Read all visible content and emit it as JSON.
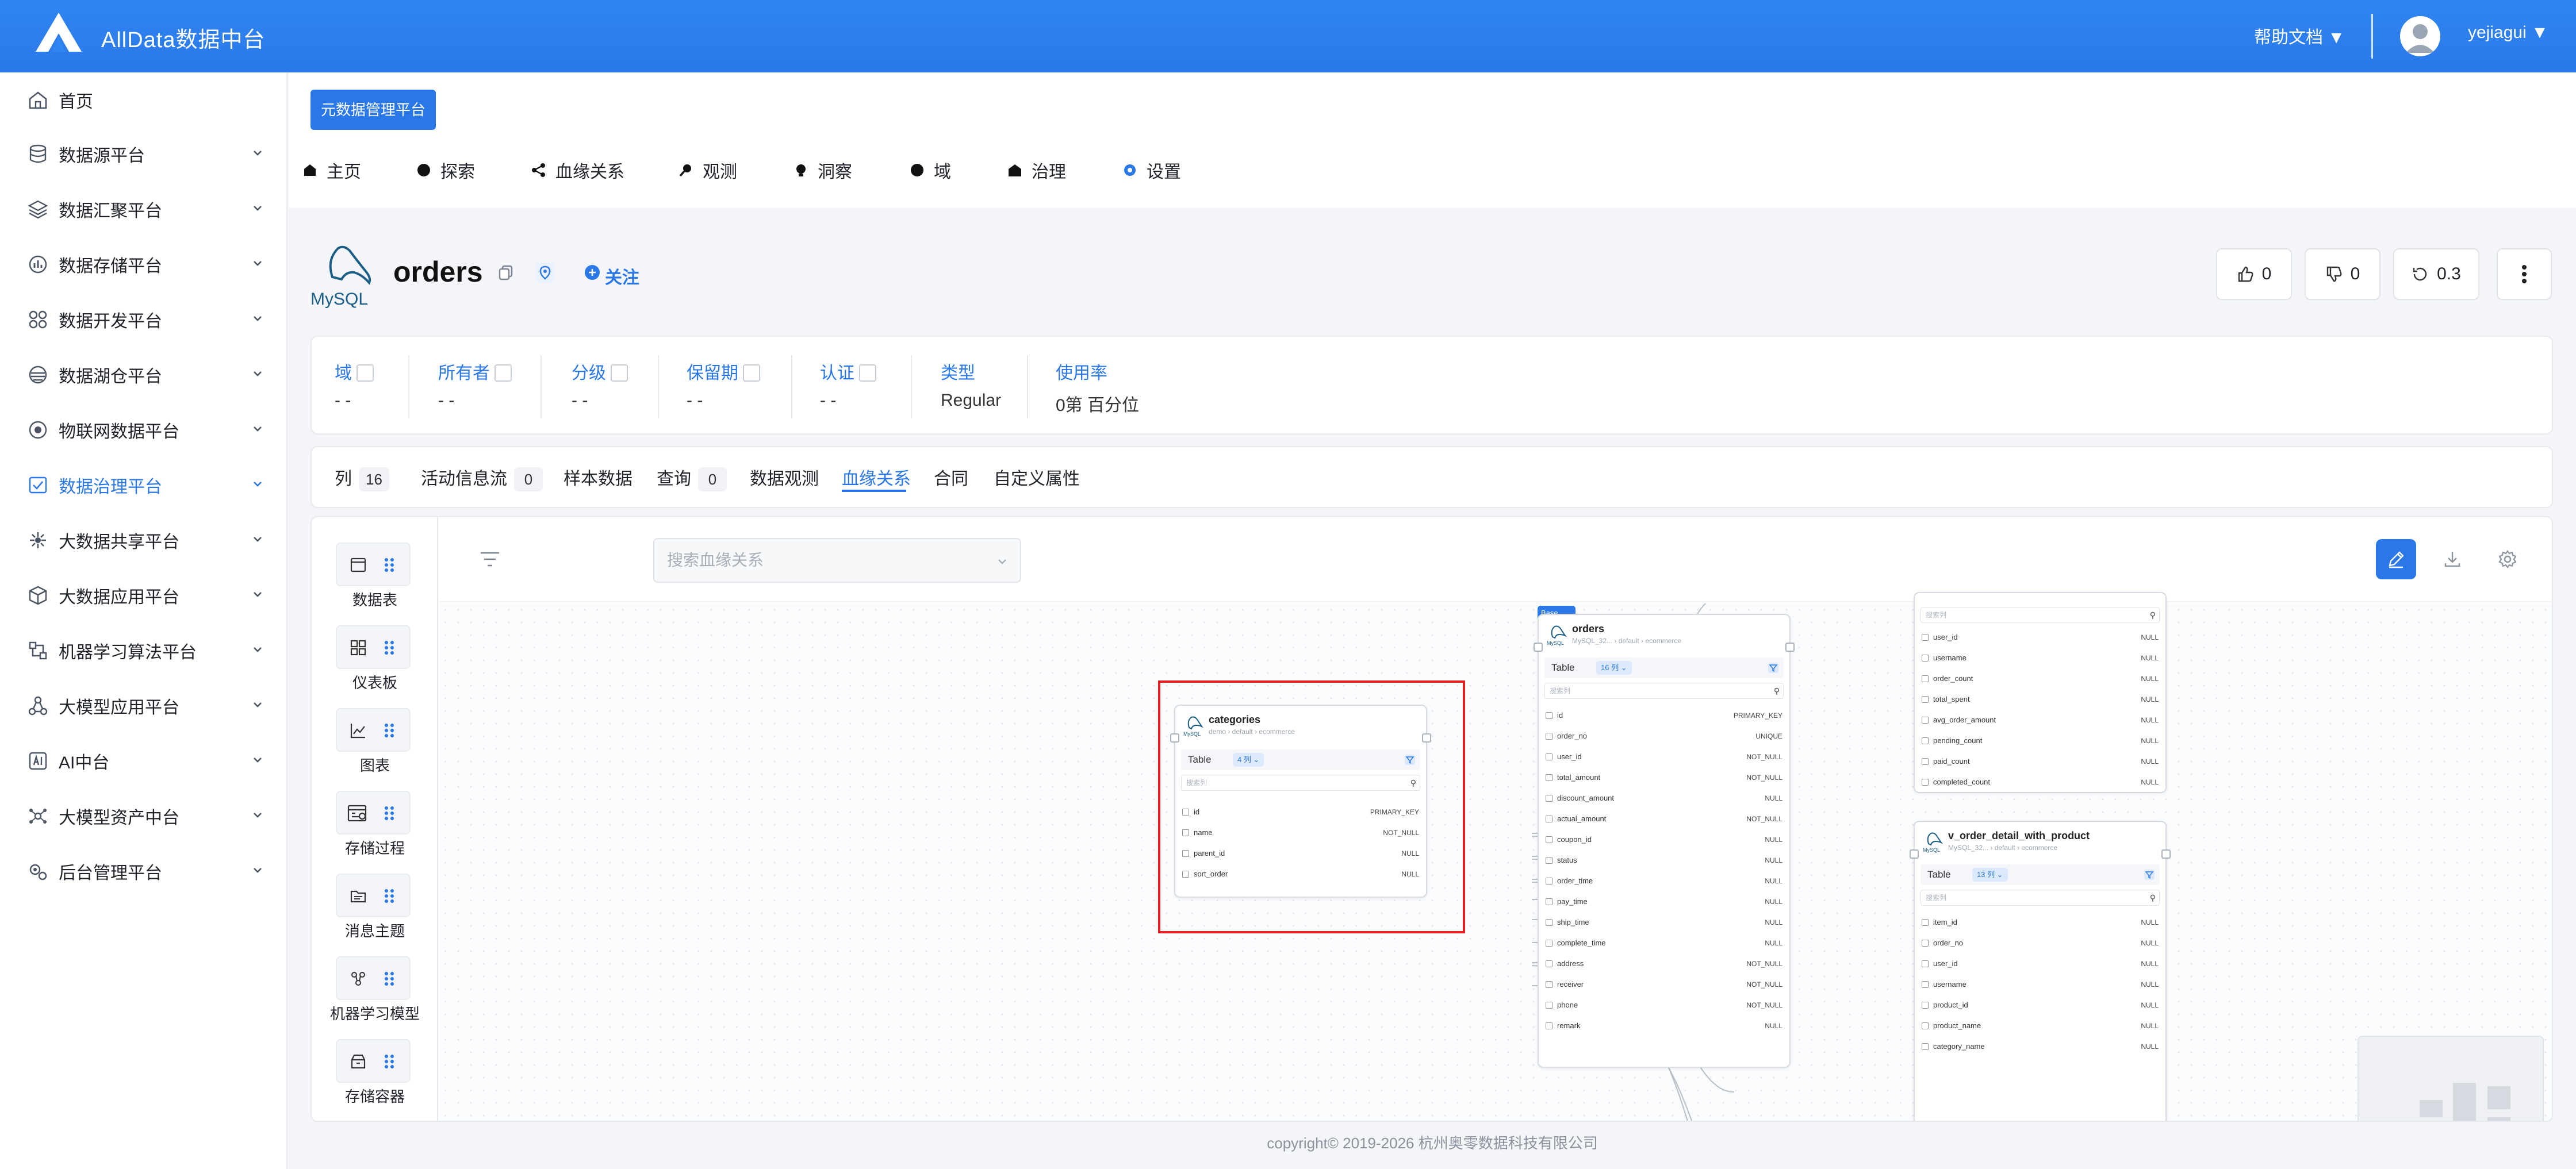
{
  "app": {
    "title": "AllData数据中台",
    "help": "帮助文档 ▼",
    "user": "yejiagui ▼"
  },
  "sidebar": {
    "items": [
      {
        "label": "首页",
        "icon": "home-icon"
      },
      {
        "label": "数据源平台",
        "icon": "database-icon"
      },
      {
        "label": "数据汇聚平台",
        "icon": "layers-icon"
      },
      {
        "label": "数据存储平台",
        "icon": "bar-chart-icon"
      },
      {
        "label": "数据开发平台",
        "icon": "code-nodes-icon"
      },
      {
        "label": "数据湖仓平台",
        "icon": "lake-icon"
      },
      {
        "label": "物联网数据平台",
        "icon": "iot-icon"
      },
      {
        "label": "数据治理平台",
        "icon": "governance-icon"
      },
      {
        "label": "大数据共享平台",
        "icon": "share-icon"
      },
      {
        "label": "大数据应用平台",
        "icon": "cube-icon"
      },
      {
        "label": "机器学习算法平台",
        "icon": "ml-icon"
      },
      {
        "label": "大模型应用平台",
        "icon": "model-icon"
      },
      {
        "label": "AI中台",
        "icon": "ai-icon"
      },
      {
        "label": "大模型资产中台",
        "icon": "asset-icon"
      },
      {
        "label": "后台管理平台",
        "icon": "gears-icon"
      }
    ]
  },
  "header": {
    "meta_button": "元数据管理平台",
    "nav": [
      "主页",
      "探索",
      "血缘关系",
      "观测",
      "洞察",
      "域",
      "治理",
      "设置"
    ]
  },
  "entity": {
    "name": "orders",
    "follow": "关注",
    "upvotes": "0",
    "downvotes": "0",
    "version": "0.3",
    "mysql_logo": "MySQL"
  },
  "meta": [
    {
      "label": "域",
      "value": "- -"
    },
    {
      "label": "所有者",
      "value": "- -"
    },
    {
      "label": "分级",
      "value": "- -"
    },
    {
      "label": "保留期",
      "value": "- -"
    },
    {
      "label": "认证",
      "value": "- -"
    },
    {
      "label": "类型",
      "value": "Regular"
    },
    {
      "label": "使用率",
      "value": "0第 百分位"
    }
  ],
  "tabs": [
    {
      "label": "列",
      "badge": "16"
    },
    {
      "label": "活动信息流",
      "badge": "0"
    },
    {
      "label": "样本数据",
      "badge": ""
    },
    {
      "label": "查询",
      "badge": "0"
    },
    {
      "label": "数据观测",
      "badge": ""
    },
    {
      "label": "血缘关系",
      "badge": ""
    },
    {
      "label": "合同",
      "badge": ""
    },
    {
      "label": "自定义属性",
      "badge": ""
    }
  ],
  "lineage": {
    "search_placeholder": "搜索血缘关系",
    "palette": [
      "数据表",
      "仪表板",
      "图表",
      "存储过程",
      "消息主题",
      "机器学习模型",
      "存储容器"
    ],
    "search_column": "搜索列",
    "nodes": {
      "categories": {
        "name": "categories",
        "sub": "demo  ›  default  ›  ecommerce",
        "type": "Table",
        "count": "4 列 ⌄",
        "rows": [
          {
            "name": "id",
            "con": "PRIMARY_KEY"
          },
          {
            "name": "name",
            "con": "NOT_NULL"
          },
          {
            "name": "parent_id",
            "con": "NULL"
          },
          {
            "name": "sort_order",
            "con": "NULL"
          }
        ]
      },
      "orders": {
        "tag": "Base",
        "name": "orders",
        "sub": "MySQL_32...  ›  default  ›  ecommerce",
        "type": "Table",
        "count": "16 列 ⌄",
        "rows": [
          {
            "name": "id",
            "con": "PRIMARY_KEY"
          },
          {
            "name": "order_no",
            "con": "UNIQUE"
          },
          {
            "name": "user_id",
            "con": "NOT_NULL"
          },
          {
            "name": "total_amount",
            "con": "NOT_NULL"
          },
          {
            "name": "discount_amount",
            "con": "NULL"
          },
          {
            "name": "actual_amount",
            "con": "NOT_NULL"
          },
          {
            "name": "coupon_id",
            "con": "NULL"
          },
          {
            "name": "status",
            "con": "NULL"
          },
          {
            "name": "order_time",
            "con": "NULL"
          },
          {
            "name": "pay_time",
            "con": "NULL"
          },
          {
            "name": "ship_time",
            "con": "NULL"
          },
          {
            "name": "complete_time",
            "con": "NULL"
          },
          {
            "name": "address",
            "con": "NOT_NULL"
          },
          {
            "name": "receiver",
            "con": "NOT_NULL"
          },
          {
            "name": "phone",
            "con": "NOT_NULL"
          },
          {
            "name": "remark",
            "con": "NULL"
          }
        ]
      },
      "user_stats": {
        "search": "搜索列",
        "rows": [
          {
            "name": "user_id",
            "con": "NULL"
          },
          {
            "name": "username",
            "con": "NULL"
          },
          {
            "name": "order_count",
            "con": "NULL"
          },
          {
            "name": "total_spent",
            "con": "NULL"
          },
          {
            "name": "avg_order_amount",
            "con": "NULL"
          },
          {
            "name": "pending_count",
            "con": "NULL"
          },
          {
            "name": "paid_count",
            "con": "NULL"
          },
          {
            "name": "completed_count",
            "con": "NULL"
          }
        ]
      },
      "v_order_detail": {
        "name": "v_order_detail_with_product",
        "sub": "MySQL_32...  ›  default  ›  ecommerce",
        "type": "Table",
        "count": "13 列 ⌄",
        "rows": [
          {
            "name": "item_id",
            "con": "NULL"
          },
          {
            "name": "order_no",
            "con": "NULL"
          },
          {
            "name": "user_id",
            "con": "NULL"
          },
          {
            "name": "username",
            "con": "NULL"
          },
          {
            "name": "product_id",
            "con": "NULL"
          },
          {
            "name": "product_name",
            "con": "NULL"
          },
          {
            "name": "category_name",
            "con": "NULL"
          }
        ]
      }
    }
  },
  "footer": "copyright© 2019-2026 杭州奥零数据科技有限公司",
  "colors": {
    "primary": "#2a78e8",
    "highlight": "#e02020"
  }
}
